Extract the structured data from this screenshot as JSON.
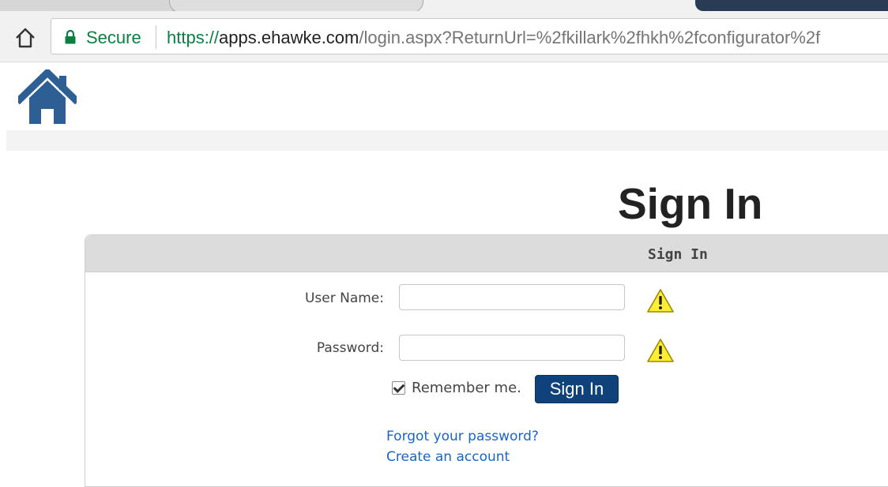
{
  "browser": {
    "secure_label": "Secure",
    "url_scheme": "https://",
    "url_host": "apps.ehawke.com",
    "url_path": "/login.aspx?ReturnUrl=%2fkillark%2fhkh%2fconfigurator%2f"
  },
  "page": {
    "title": "Sign In"
  },
  "login_panel": {
    "header": "Sign In",
    "username_label": "User Name:",
    "username_value": "",
    "password_label": "Password:",
    "password_value": "",
    "remember_label": "Remember me.",
    "remember_checked": true,
    "signin_button": "Sign In",
    "forgot_link": "Forgot your password?",
    "create_link": "Create an account"
  },
  "icons": {
    "browser_home": "home-icon",
    "lock": "lock-icon",
    "site_home": "house-icon",
    "warning": "warning-icon"
  },
  "colors": {
    "brand_blue": "#2e5f94",
    "button_blue": "#0f427a",
    "secure_green": "#0b8043",
    "link_blue": "#1a64c8",
    "warning_yellow": "#ffee33"
  }
}
